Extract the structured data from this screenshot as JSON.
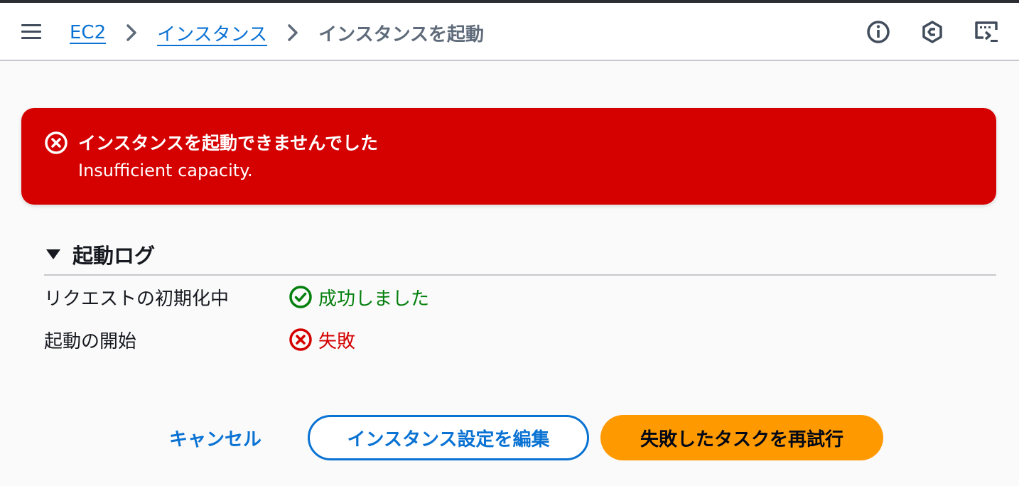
{
  "header": {
    "breadcrumbs": [
      {
        "label": "EC2",
        "link": true
      },
      {
        "label": "インスタンス",
        "link": true
      },
      {
        "label": "インスタンスを起動",
        "link": false
      }
    ],
    "icons": [
      "menu-icon",
      "info-icon",
      "cloudshell-icon",
      "console-to-code-icon"
    ]
  },
  "alert": {
    "type": "error",
    "icon": "error-circle-icon",
    "title": "インスタンスを起動できませんでした",
    "message": "Insufficient capacity.",
    "color": "#d50000"
  },
  "log": {
    "title": "起動ログ",
    "expanded": true,
    "rows": [
      {
        "label": "リクエストの初期化中",
        "status": "成功しました",
        "status_type": "success",
        "icon": "check-circle-icon",
        "color": "#037f0c"
      },
      {
        "label": "起動の開始",
        "status": "失敗",
        "status_type": "error",
        "icon": "error-circle-icon",
        "color": "#d50000"
      }
    ]
  },
  "actions": {
    "cancel": "キャンセル",
    "edit": "インスタンス設定を編集",
    "retry": "失敗したタスクを再試行"
  },
  "colors": {
    "link": "#0972d3",
    "primary_button": "#ff9900"
  }
}
